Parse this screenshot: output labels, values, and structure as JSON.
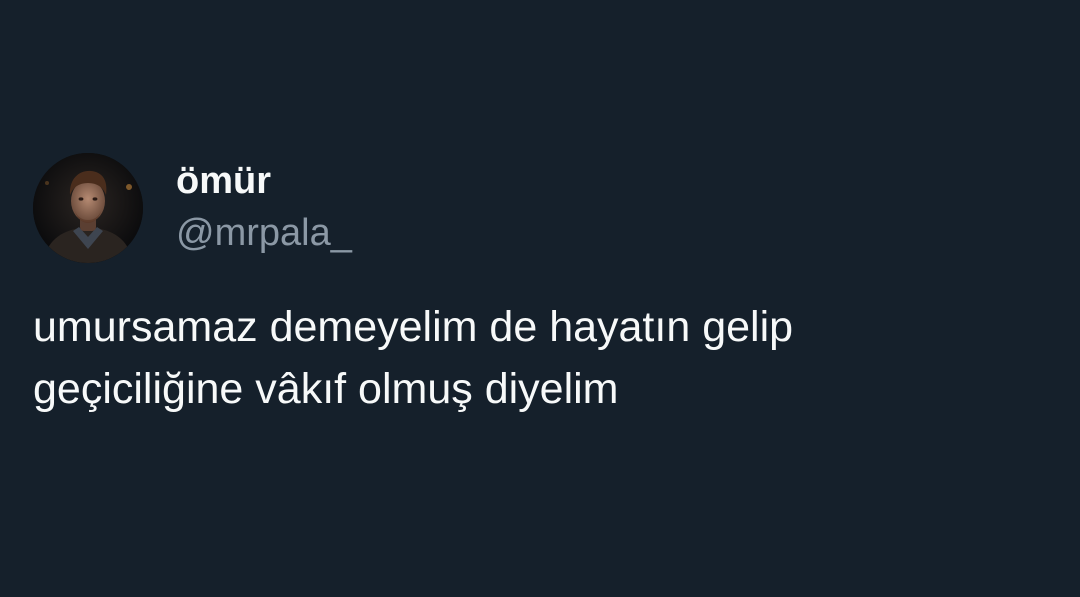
{
  "tweet": {
    "author": {
      "display_name": "ömür",
      "handle": "@mrpala_",
      "avatar_icon": "profile-photo-avatar"
    },
    "text": "umursamaz demeyelim de hayatın gelip\ngeçiciliğine vâkıf olmuş diyelim"
  },
  "colors": {
    "background": "#15202b",
    "primary_text": "#f7f9f9",
    "secondary_text": "#8b98a5"
  }
}
